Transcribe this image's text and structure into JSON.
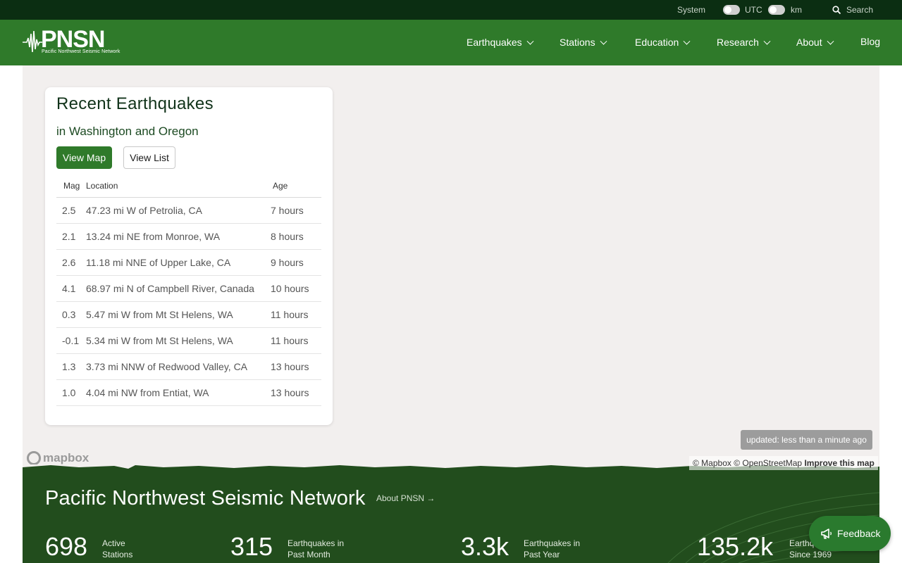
{
  "utility_bar": {
    "theme_label": "System",
    "utc_label": "UTC",
    "km_label": "km",
    "search_label": "Search"
  },
  "nav": {
    "logo_text": "PNSN",
    "logo_subtext": "Pacific Northwest Seismic Network",
    "items": [
      {
        "label": "Earthquakes",
        "icon": "chevron-down-icon"
      },
      {
        "label": "Stations",
        "icon": "chevron-down-icon"
      },
      {
        "label": "Education",
        "icon": "chevron-down-icon"
      },
      {
        "label": "Research",
        "icon": "chevron-down-icon"
      },
      {
        "label": "About",
        "icon": "chevron-down-icon"
      }
    ],
    "blog_label": "Blog"
  },
  "recent": {
    "title": "Recent Earthquakes",
    "subtitle": "in Washington and Oregon",
    "view_map_label": "View Map",
    "view_list_label": "View List",
    "columns": {
      "mag": "Mag",
      "location": "Location",
      "age": "Age"
    },
    "rows": [
      {
        "mag": "2.5",
        "location": "47.23 mi W of Petrolia, CA",
        "age": "7 hours"
      },
      {
        "mag": "2.1",
        "location": "13.24 mi NE from Monroe, WA",
        "age": "8 hours"
      },
      {
        "mag": "2.6",
        "location": "11.18 mi NNE of Upper Lake, CA",
        "age": "9 hours"
      },
      {
        "mag": "4.1",
        "location": "68.97 mi N of Campbell River, Canada",
        "age": "10 hours"
      },
      {
        "mag": "0.3",
        "location": "5.47 mi W from Mt St Helens, WA",
        "age": "11 hours"
      },
      {
        "mag": "-0.1",
        "location": "5.34 mi W from Mt St Helens, WA",
        "age": "11 hours"
      },
      {
        "mag": "1.3",
        "location": "3.73 mi NNW of Redwood Valley, CA",
        "age": "13 hours"
      },
      {
        "mag": "1.0",
        "location": "4.04 mi NW from Entiat, WA",
        "age": "13 hours"
      }
    ]
  },
  "map": {
    "updated_text": "updated: less than a minute ago",
    "mapbox_logo": "mapbox",
    "attribution_mapbox": "© Mapbox",
    "attribution_osm": "© OpenStreetMap",
    "improve_label": "Improve this map"
  },
  "footer": {
    "title": "Pacific Northwest Seismic Network",
    "about_link": "About PNSN →",
    "stats": [
      {
        "value": "698",
        "label_line1": "Active",
        "label_line2": "Stations"
      },
      {
        "value": "315",
        "label_line1": "Earthquakes in",
        "label_line2": "Past Month"
      },
      {
        "value": "3.3k",
        "label_line1": "Earthquakes in",
        "label_line2": "Past Year"
      },
      {
        "value": "135.2k",
        "label_line1": "Earthq",
        "label_line2": "Since 1969"
      }
    ]
  },
  "feedback_label": "Feedback",
  "colors": {
    "nav_green": "#2f7a2a",
    "utility_bar": "#0b2e12",
    "footer_band": "#224d1d",
    "map_background": "#f2efee"
  }
}
